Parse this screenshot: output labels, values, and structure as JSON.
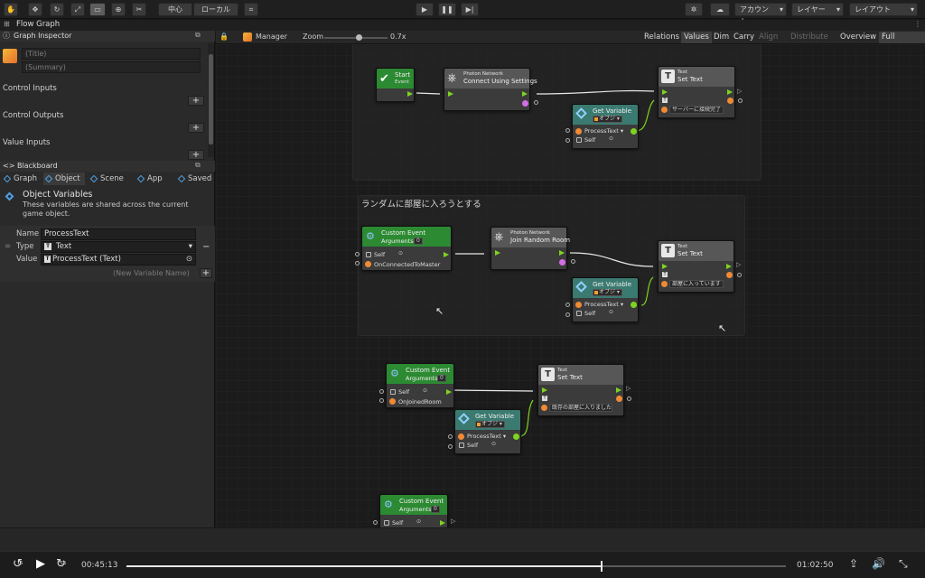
{
  "toolbar": {
    "pivot_label": "中心",
    "space_label": "ローカル",
    "account_label": "アカウント",
    "layers_label": "レイヤー",
    "layout_label": "レイアウト"
  },
  "window": {
    "tab_label": "Flow Graph"
  },
  "inspector": {
    "title": "Graph Inspector",
    "title_placeholder": "(Title)",
    "summary_placeholder": "(Summary)",
    "control_inputs": "Control Inputs",
    "control_outputs": "Control Outputs",
    "value_inputs": "Value Inputs"
  },
  "blackboard": {
    "title": "<> Blackboard",
    "tabs": [
      "Graph",
      "Object",
      "Scene",
      "App",
      "Saved"
    ],
    "heading": "Object Variables",
    "description": "These variables are shared across the current game object.",
    "name_label": "Name",
    "name_value": "ProcessText",
    "type_label": "Type",
    "type_value": "Text",
    "value_label": "Value",
    "value_value": "ProcessText (Text)",
    "new_var_placeholder": "(New Variable Name)"
  },
  "graph_toolbar": {
    "context": "Manager",
    "zoom_label": "Zoom",
    "zoom_value": "0.7x",
    "zoom_fraction": 0.55,
    "buttons": [
      "Relations",
      "Values",
      "Dim",
      "Carry",
      "Align",
      "Distribute",
      "Overview",
      "Full Screen"
    ],
    "active": [
      "Values",
      "Full Screen"
    ],
    "disabled": [
      "Align",
      "Distribute"
    ]
  },
  "graph": {
    "group2_title": "ランダムに部屋に入ろうとする",
    "start": {
      "title": "Start",
      "subtitle": "Event"
    },
    "connect": {
      "small": "Photon Network",
      "title": "Connect Using Settings"
    },
    "join": {
      "small": "Photon Network",
      "title": "Join Random Room"
    },
    "settext1": {
      "small": "Text",
      "title": "Set Text",
      "value": "サーバーに接続完了"
    },
    "settext2": {
      "small": "Text",
      "title": "Set Text",
      "value": "部屋に入っています"
    },
    "settext3": {
      "small": "Text",
      "title": "Set Text",
      "value": "既存の部屋に入りました"
    },
    "getvar": {
      "title": "Get Variable",
      "scope": "オブジ",
      "name": "ProcessText",
      "target": "Self"
    },
    "custom1": {
      "title": "Custom Event",
      "args": "Arguments",
      "argcount": "0",
      "target": "Self",
      "event": "OnConnectedToMaster"
    },
    "custom2": {
      "title": "Custom Event",
      "args": "Arguments",
      "argcount": "0",
      "target": "Self",
      "event": "OnJoinedRoom"
    },
    "custom3": {
      "title": "Custom Event",
      "args": "Arguments",
      "argcount": "0",
      "target": "Self"
    }
  },
  "player": {
    "elapsed": "00:45:13",
    "total": "01:02:50",
    "progress": 0.72,
    "skip_back": "15",
    "skip_fwd": "15"
  }
}
